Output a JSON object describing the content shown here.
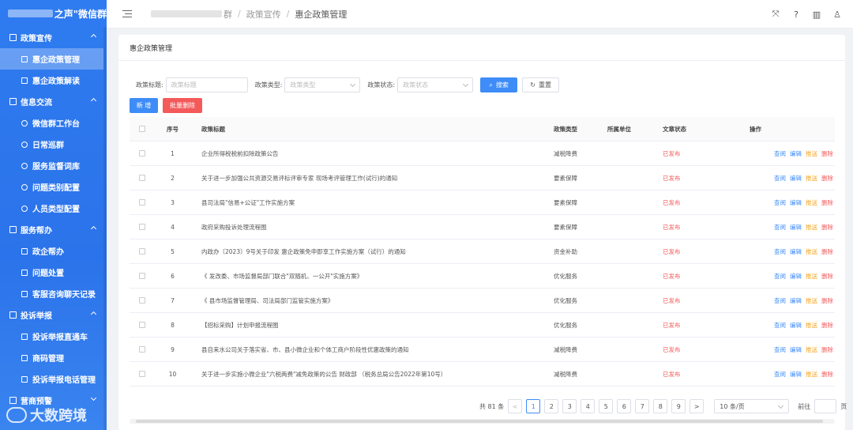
{
  "app": {
    "brand_suffix": "之声\"微信群"
  },
  "sidebar": {
    "groups": [
      {
        "label": "政策宣传",
        "items": [
          "惠企政策管理",
          "惠企政策解读"
        ]
      },
      {
        "label": "信息交流",
        "items": [
          "微信群工作台",
          "日常巡群",
          "服务监督词库",
          "问题类别配置",
          "人员类型配置"
        ]
      },
      {
        "label": "服务帮办",
        "items": [
          "政企帮办",
          "问题处置",
          "客服咨询聊天记录"
        ]
      },
      {
        "label": "投诉举报",
        "items": [
          "投诉举报直通车",
          "商码管理",
          "投诉举报电话管理"
        ]
      },
      {
        "label": "营商预警",
        "items": []
      }
    ],
    "active_item": "惠企政策管理"
  },
  "watermark": "大数跨境",
  "breadcrumb": {
    "part1_suffix": "群",
    "part2": "政策宣传",
    "part3": "惠企政策管理"
  },
  "panel": {
    "title": "惠企政策管理"
  },
  "search": {
    "title_label": "政策标题:",
    "title_placeholder": "政策标题",
    "type_label": "政策类型:",
    "type_placeholder": "政策类型",
    "status_label": "政策状态:",
    "status_placeholder": "政策状态",
    "search_button": "搜索",
    "reset_button": "重置"
  },
  "actions": {
    "add": "新 增",
    "batch_delete": "批量删除"
  },
  "table": {
    "headers": {
      "no": "序号",
      "title": "政策标题",
      "type": "政策类型",
      "unit": "所属单位",
      "status": "文章状态",
      "ops": "操作"
    },
    "ops": {
      "view": "查阅",
      "edit": "编辑",
      "push": "推送",
      "delete": "删除"
    },
    "rows": [
      {
        "no": "1",
        "title": "企业所得税税前扣除政策公告",
        "type": "减税降费",
        "unit": "",
        "status": "已发布"
      },
      {
        "no": "2",
        "title": "关于进一步加强公共资源交易评标评审专家 现场考评管理工作(试行)的通知",
        "type": "要素保障",
        "unit": "",
        "status": "已发布"
      },
      {
        "no": "3",
        "title": "县司法局\"信易+公证\"工作实施方案",
        "type": "要素保障",
        "unit": "",
        "status": "已发布"
      },
      {
        "no": "4",
        "title": "政府采购投诉处理流程图",
        "type": "要素保障",
        "unit": "",
        "status": "已发布"
      },
      {
        "no": "5",
        "title": "内政办〔2023〕9号关于印发 惠企政策免申即享工作实施方案（试行）的通知",
        "type": "资金补助",
        "unit": "",
        "status": "已发布"
      },
      {
        "no": "6",
        "title": "《 发改委、市场监督局部门联合\"双随机、一公开\"实施方案》",
        "type": "优化服务",
        "unit": "",
        "status": "已发布"
      },
      {
        "no": "7",
        "title": "《 县市场监督管理局、司法局部门监管实施方案》",
        "type": "优化服务",
        "unit": "",
        "status": "已发布"
      },
      {
        "no": "8",
        "title": "【招标采购】计划申报流程图",
        "type": "优化服务",
        "unit": "",
        "status": "已发布"
      },
      {
        "no": "9",
        "title": "县自来水公司关于落实省、市、县小微企业和个体工商户阶段性优惠政策的通知",
        "type": "减税降费",
        "unit": "",
        "status": "已发布"
      },
      {
        "no": "10",
        "title": "关于进一步实施小微企业\"六税两费\"减免政策的公告 财政部 （税务总局公告2022年第10号）",
        "type": "减税降费",
        "unit": "",
        "status": "已发布"
      }
    ]
  },
  "pagination": {
    "total": "共 81 条",
    "pages": [
      "1",
      "2",
      "3",
      "4",
      "5",
      "6",
      "7",
      "8",
      "9"
    ],
    "current": "1",
    "prev": "<",
    "next": ">",
    "page_size": "10 条/页",
    "jump_label": "前往",
    "jump_suffix": "页"
  }
}
